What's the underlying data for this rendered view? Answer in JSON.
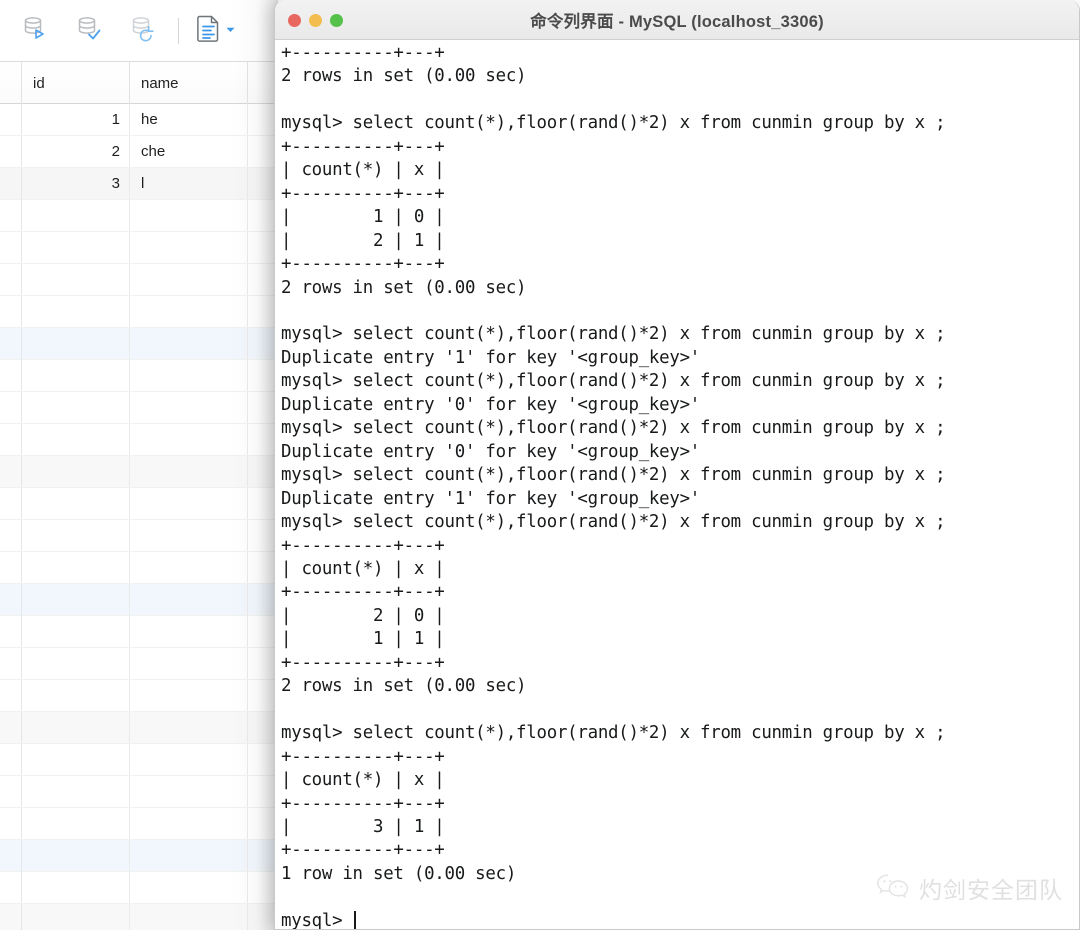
{
  "window": {
    "title": "命令列界面 - MySQL (localhost_3306)",
    "lights": [
      {
        "name": "close",
        "color": "#e8685f"
      },
      {
        "name": "minimize",
        "color": "#f4bd4f"
      },
      {
        "name": "zoom",
        "color": "#56c14a"
      }
    ]
  },
  "toolbar": {
    "buttons": [
      {
        "icon": "database-run-icon",
        "label": "Run"
      },
      {
        "icon": "database-commit-icon",
        "label": "Commit"
      },
      {
        "icon": "database-rollback-icon",
        "label": "Rollback"
      },
      {
        "icon": "document-result-icon",
        "label": "Result Grid"
      }
    ]
  },
  "grid": {
    "columns": [
      "id",
      "name"
    ],
    "rows": [
      {
        "id": "1",
        "name": "he"
      },
      {
        "id": "2",
        "name": "che"
      },
      {
        "id": "3",
        "name": "l"
      }
    ],
    "empty_row_count": 23
  },
  "terminal": {
    "prompt": "mysql> ",
    "cursor": "|",
    "text": "+----------+---+\n2 rows in set (0.00 sec)\n\nmysql> select count(*),floor(rand()*2) x from cunmin group by x ;\n+----------+---+\n| count(*) | x |\n+----------+---+\n|        1 | 0 |\n|        2 | 1 |\n+----------+---+\n2 rows in set (0.00 sec)\n\nmysql> select count(*),floor(rand()*2) x from cunmin group by x ;\nDuplicate entry '1' for key '<group_key>'\nmysql> select count(*),floor(rand()*2) x from cunmin group by x ;\nDuplicate entry '0' for key '<group_key>'\nmysql> select count(*),floor(rand()*2) x from cunmin group by x ;\nDuplicate entry '0' for key '<group_key>'\nmysql> select count(*),floor(rand()*2) x from cunmin group by x ;\nDuplicate entry '1' for key '<group_key>'\nmysql> select count(*),floor(rand()*2) x from cunmin group by x ;\n+----------+---+\n| count(*) | x |\n+----------+---+\n|        2 | 0 |\n|        1 | 1 |\n+----------+---+\n2 rows in set (0.00 sec)\n\nmysql> select count(*),floor(rand()*2) x from cunmin group by x ;\n+----------+---+\n| count(*) | x |\n+----------+---+\n|        3 | 1 |\n+----------+---+\n1 row in set (0.00 sec)\n\nmysql> "
  },
  "watermark": {
    "icon": "wechat-icon",
    "text": "灼剑安全团队"
  }
}
